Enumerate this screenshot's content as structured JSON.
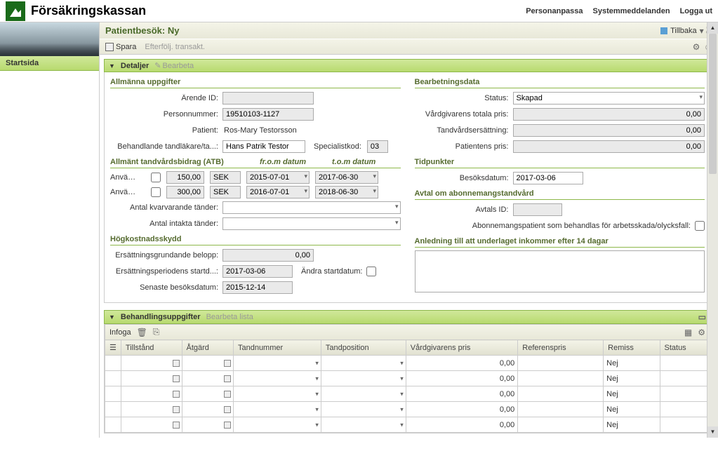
{
  "org_name": "Försäkringskassan",
  "toplinks": {
    "personalize": "Personanpassa",
    "sysmsg": "Systemmeddelanden",
    "logout": "Logga ut"
  },
  "start_label": "Startsida",
  "page_title": "Patientbesök: Ny",
  "back_label": "Tillbaka",
  "toolbar": {
    "save": "Spara",
    "followup": "Efterfölj. transakt."
  },
  "panel1": {
    "title": "Detaljer",
    "edit": "Bearbeta"
  },
  "general": {
    "section": "Allmänna uppgifter",
    "arende_lbl": "Ärende ID:",
    "arende_val": "",
    "person_lbl": "Personnummer:",
    "person_val": "19510103-1127",
    "patient_lbl": "Patient:",
    "patient_val": "Ros-Mary Testorsson",
    "dentist_lbl": "Behandlande tandläkare/ta...:",
    "dentist_val": "Hans Patrik Testor",
    "spec_lbl": "Specialistkod:",
    "spec_val": "03"
  },
  "atb": {
    "section": "Allmänt tandvårdsbidrag (ATB)",
    "from_lbl": "fr.o.m datum",
    "to_lbl": "t.o.m datum",
    "use_lbl": "Anvä…",
    "rows": [
      {
        "amount": "150,00",
        "currency": "SEK",
        "from": "2015-07-01",
        "to": "2017-06-30"
      },
      {
        "amount": "300,00",
        "currency": "SEK",
        "from": "2016-07-01",
        "to": "2018-06-30"
      }
    ],
    "remaining_lbl": "Antal kvarvarande tänder:",
    "intact_lbl": "Antal intakta tänder:"
  },
  "hks": {
    "section": "Högkostnadsskydd",
    "egb_lbl": "Ersättningsgrundande belopp:",
    "egb_val": "0,00",
    "eps_lbl": "Ersättningsperiodens startd...:",
    "eps_val": "2017-03-06",
    "chg_lbl": "Ändra startdatum:",
    "last_lbl": "Senaste besöksdatum:",
    "last_val": "2015-12-14"
  },
  "proc": {
    "section": "Bearbetningsdata",
    "status_lbl": "Status:",
    "status_val": "Skapad",
    "total_lbl": "Vårdgivarens totala pris:",
    "total_val": "0,00",
    "ers_lbl": "Tandvårdsersättning:",
    "ers_val": "0,00",
    "pat_lbl": "Patientens pris:",
    "pat_val": "0,00"
  },
  "times": {
    "section": "Tidpunkter",
    "visit_lbl": "Besöksdatum:",
    "visit_val": "2017-03-06"
  },
  "abonn": {
    "section": "Avtal om abonnemangstandvård",
    "avtal_lbl": "Avtals ID:",
    "work_lbl": "Abonnemangspatient som behandlas för arbetsskada/olycksfall:"
  },
  "reason": {
    "section": "Anledning till att underlaget inkommer efter 14 dagar"
  },
  "panel2": {
    "title": "Behandlingsuppgifter",
    "edit": "Bearbeta lista",
    "insert": "Infoga"
  },
  "grid": {
    "headers": {
      "tillstand": "Tillstånd",
      "atgard": "Åtgärd",
      "tandnr": "Tandnummer",
      "tandpos": "Tandposition",
      "pris": "Vårdgivarens pris",
      "ref": "Referenspris",
      "remiss": "Remiss",
      "status": "Status"
    },
    "rows": [
      {
        "pris": "0,00",
        "remiss": "Nej"
      },
      {
        "pris": "0,00",
        "remiss": "Nej"
      },
      {
        "pris": "0,00",
        "remiss": "Nej"
      },
      {
        "pris": "0,00",
        "remiss": "Nej"
      },
      {
        "pris": "0,00",
        "remiss": "Nej"
      }
    ]
  }
}
